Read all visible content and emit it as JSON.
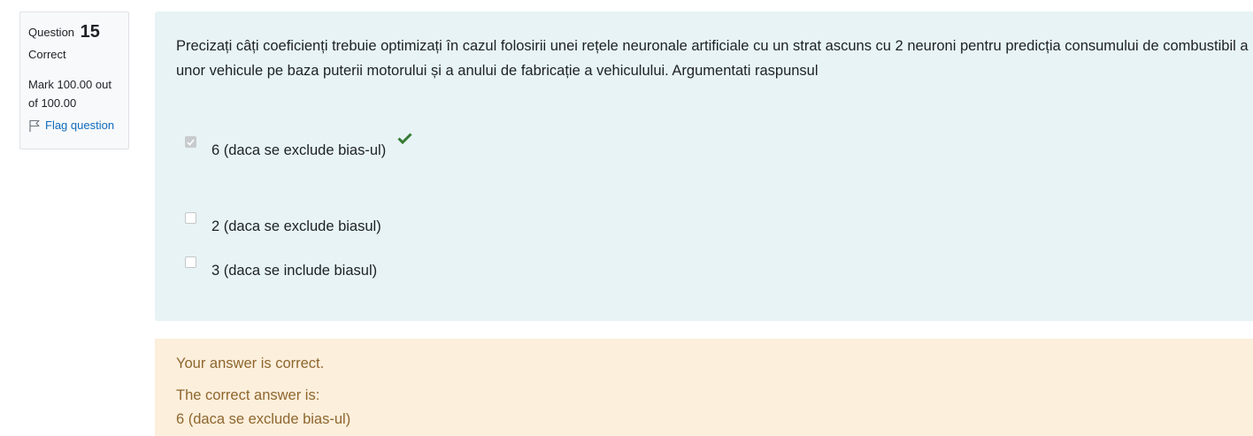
{
  "info": {
    "question_label": "Question",
    "question_number": "15",
    "state": "Correct",
    "grade": "Mark 100.00 out of 100.00",
    "flag_label": "Flag question"
  },
  "question": {
    "text": "Precizați câți coeficienți trebuie optimizați în cazul folosirii unei rețele neuronale artificiale cu un strat ascuns cu 2 neuroni pentru predicția consumului de combustibil a unor vehicule pe baza puterii motorului și a anului de fabricație a vehiculului. Argumentati raspunsul",
    "options": [
      {
        "label": "6 (daca se exclude bias-ul)",
        "checked": true,
        "correct": true
      },
      {
        "label": "2 (daca se exclude biasul)",
        "checked": false
      },
      {
        "label": "3 (daca se include biasul)",
        "checked": false
      }
    ]
  },
  "outcome": {
    "feedback": "Your answer is correct.",
    "right_answer_label": "The correct answer is:",
    "right_answer_value": "6 (daca se exclude bias-ul)"
  },
  "colors": {
    "formulation_bg": "#e7f3f5",
    "outcome_bg": "#fcefdc",
    "outcome_text": "#8e662e",
    "correct_tick": "#357a32",
    "link": "#0f6cbf"
  },
  "icons": {
    "flag": "flag-icon",
    "tick": "check-icon"
  }
}
